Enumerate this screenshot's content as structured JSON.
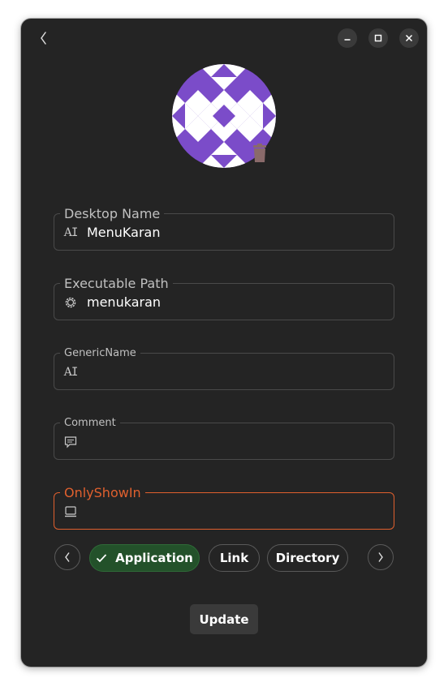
{
  "window": {
    "buttons": [
      "back-icon",
      "minimize-icon",
      "maximize-icon",
      "close-icon"
    ]
  },
  "avatar": {
    "colors": {
      "pattern": "#7b4cc9",
      "background": "#ffffff",
      "trash": "#8a6a6a"
    }
  },
  "fields": {
    "desktop_name": {
      "label": "Desktop Name",
      "value": "MenuKaran",
      "icon": "text-icon"
    },
    "executable_path": {
      "label": "Executable Path",
      "value": "menukaran",
      "icon": "gear-icon"
    },
    "generic_name": {
      "label": "GenericName",
      "value": "",
      "icon": "text-icon"
    },
    "comment": {
      "label": "Comment",
      "value": "",
      "icon": "comment-icon"
    },
    "only_show_in": {
      "label": "OnlyShowIn",
      "value": "",
      "icon": "monitor-icon",
      "state": "error"
    }
  },
  "type_selector": {
    "options": [
      {
        "label": "Application",
        "selected": true
      },
      {
        "label": "Link",
        "selected": false
      },
      {
        "label": "Directory",
        "selected": false
      }
    ]
  },
  "update_label": "Update",
  "colors": {
    "window": "#242424",
    "accent_selected": "#23512a",
    "error": "#e0602e",
    "border": "#4a4a4a"
  }
}
